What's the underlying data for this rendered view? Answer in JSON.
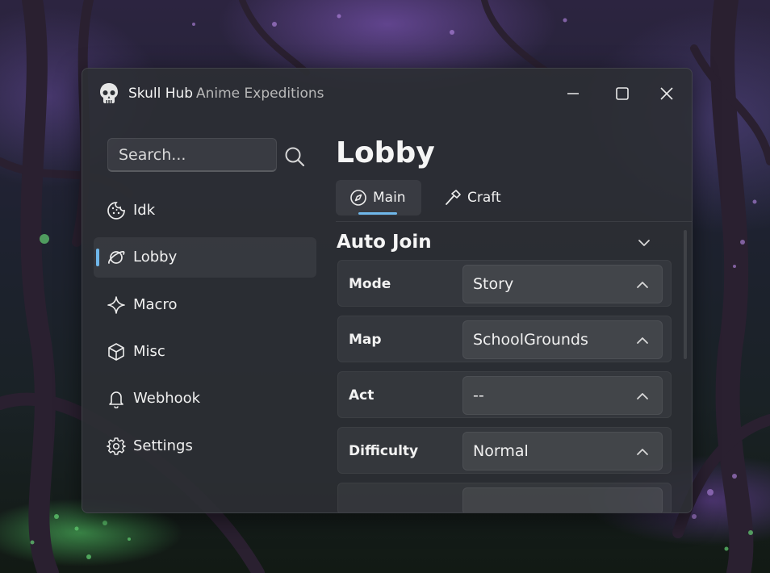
{
  "window": {
    "app_name": "Skull Hub",
    "subtitle": "Anime Expeditions",
    "controls": {
      "minimize_icon": "minimize-icon",
      "maximize_icon": "maximize-icon",
      "close_icon": "close-icon"
    }
  },
  "sidebar": {
    "search": {
      "placeholder": "Search...",
      "icon": "search-icon"
    },
    "items": [
      {
        "label": "Idk",
        "icon": "cookie-icon",
        "active": false
      },
      {
        "label": "Lobby",
        "icon": "planet-icon",
        "active": true
      },
      {
        "label": "Macro",
        "icon": "sparkle-icon",
        "active": false
      },
      {
        "label": "Misc",
        "icon": "box-icon",
        "active": false
      },
      {
        "label": "Webhook",
        "icon": "bell-icon",
        "active": false
      },
      {
        "label": "Settings",
        "icon": "gear-icon",
        "active": false
      }
    ]
  },
  "main": {
    "title": "Lobby",
    "tabs": [
      {
        "label": "Main",
        "icon": "compass-icon",
        "active": true
      },
      {
        "label": "Craft",
        "icon": "hammer-icon",
        "active": false
      }
    ],
    "section": {
      "title": "Auto Join",
      "rows": [
        {
          "label": "Mode",
          "value": "Story"
        },
        {
          "label": "Map",
          "value": "SchoolGrounds"
        },
        {
          "label": "Act",
          "value": "--"
        },
        {
          "label": "Difficulty",
          "value": "Normal"
        }
      ]
    }
  },
  "colors": {
    "accent": "#6fb7ea",
    "window_bg": "#2c2f34",
    "text": "#f2f2f2"
  }
}
